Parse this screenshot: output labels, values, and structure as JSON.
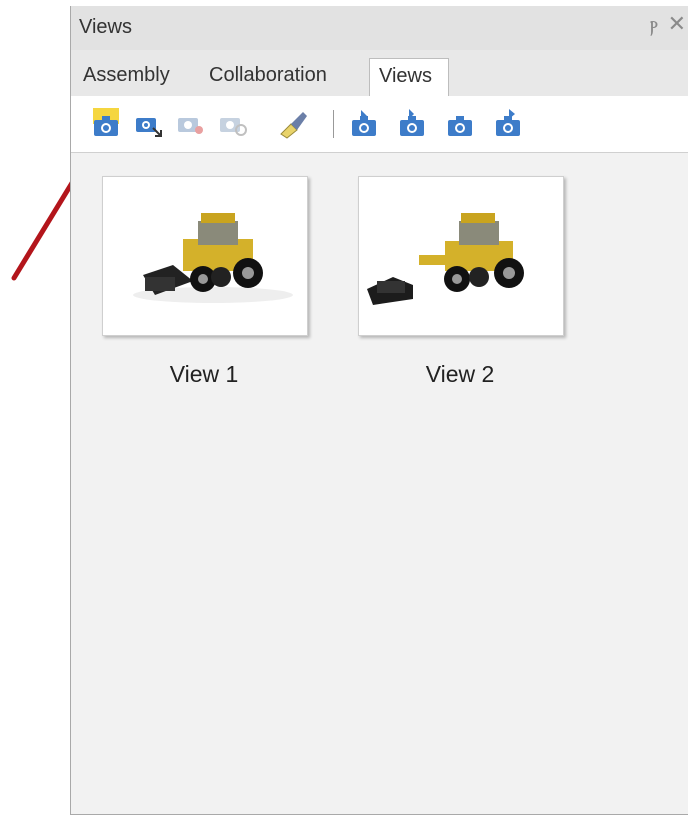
{
  "panel": {
    "title": "Views",
    "pin_glyph": "ⲣ",
    "close_glyph": "✕"
  },
  "tabs": [
    {
      "label": "Assembly",
      "active": false
    },
    {
      "label": "Collaboration",
      "active": false
    },
    {
      "label": "Views",
      "active": true
    }
  ],
  "toolbar": {
    "buttons": [
      {
        "icon": "new-view-camera-icon",
        "enabled": true,
        "highlighted": true
      },
      {
        "icon": "update-view-camera-icon",
        "enabled": true
      },
      {
        "icon": "delete-view-camera-icon",
        "enabled": false
      },
      {
        "icon": "view-settings-camera-icon",
        "enabled": false
      },
      {
        "icon": "paint-brush-icon",
        "enabled": true
      },
      {
        "icon": "move-first-camera-icon",
        "enabled": true
      },
      {
        "icon": "move-up-camera-icon",
        "enabled": true
      },
      {
        "icon": "move-down-camera-icon",
        "enabled": true
      },
      {
        "icon": "move-last-camera-icon",
        "enabled": true
      }
    ]
  },
  "views": [
    {
      "label": "View 1"
    },
    {
      "label": "View 2"
    }
  ],
  "colors": {
    "annotation_arrow": "#b3151b",
    "camera_blue": "#3d7cc9",
    "highlight_yellow": "#f5d640",
    "loader_yellow": "#d4b12a"
  }
}
